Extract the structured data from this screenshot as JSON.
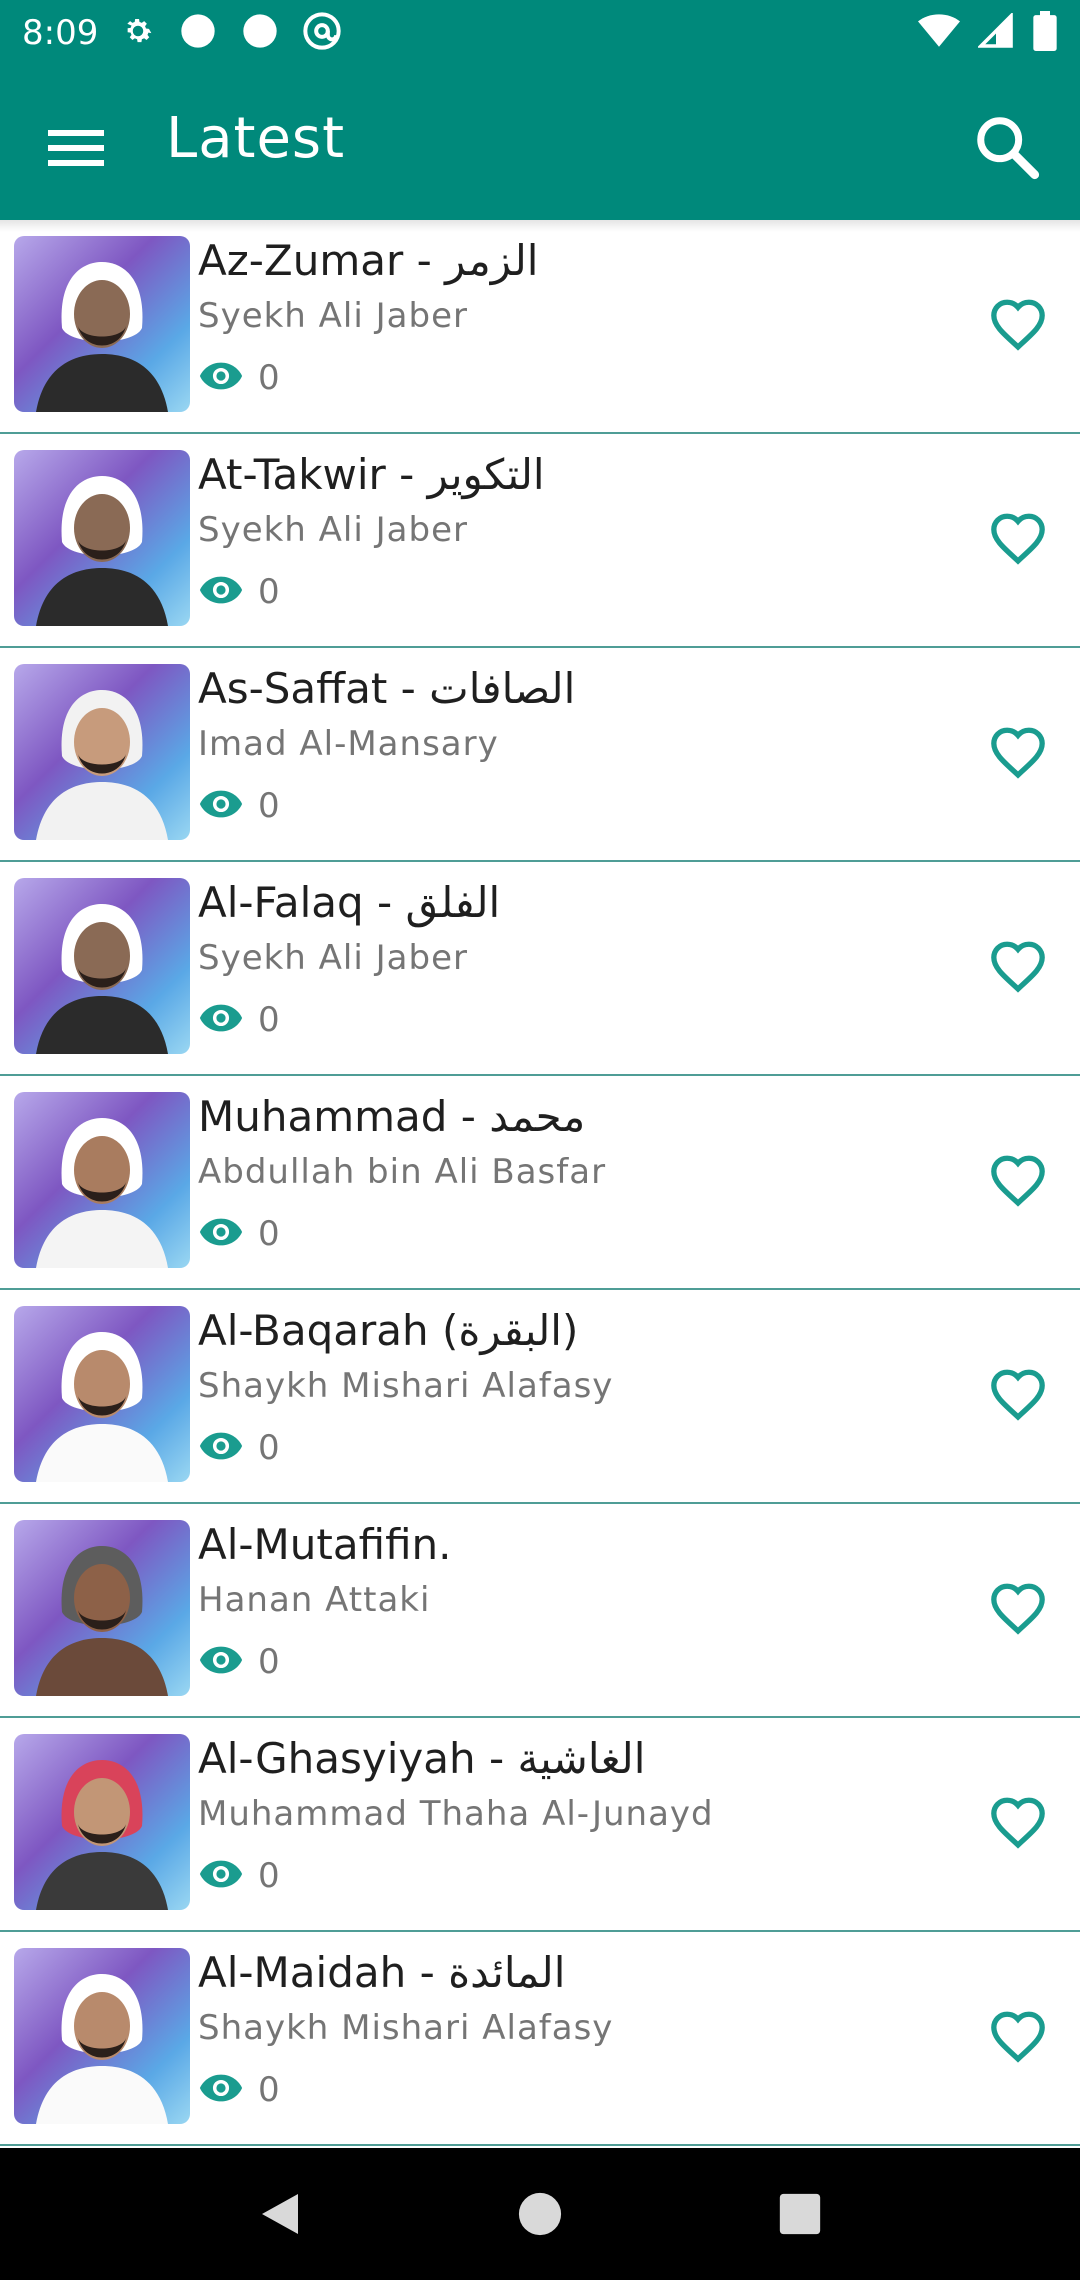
{
  "status_bar": {
    "time": "8:09",
    "icons_left": [
      "settings-icon",
      "circle-icon",
      "circle-icon",
      "at-sign-icon"
    ],
    "icons_right": [
      "wifi-icon",
      "signal-icon",
      "battery-icon"
    ]
  },
  "app_bar": {
    "title": "Latest",
    "menu_icon": "hamburger-menu-icon",
    "search_icon": "search-icon",
    "color": "#00897b"
  },
  "colors": {
    "accent": "#00897b",
    "icon_teal": "#1a9c8f",
    "divider": "#4f9d96"
  },
  "items": [
    {
      "title": "Az-Zumar - الزمر",
      "reciter": "Syekh Ali Jaber",
      "views": "0",
      "avatar": "reciter-photo-ali-jaber"
    },
    {
      "title": "At-Takwir - التكوير",
      "reciter": "Syekh Ali Jaber",
      "views": "0",
      "avatar": "reciter-photo-ali-jaber"
    },
    {
      "title": "As-Saffat - الصافات",
      "reciter": "Imad Al-Mansary",
      "views": "0",
      "avatar": "reciter-photo-imad-al-mansary"
    },
    {
      "title": "Al-Falaq - الفلق",
      "reciter": "Syekh Ali Jaber",
      "views": "0",
      "avatar": "reciter-photo-ali-jaber"
    },
    {
      "title": "Muhammad - محمد",
      "reciter": "Abdullah bin Ali Basfar",
      "views": "0",
      "avatar": "reciter-photo-basfar"
    },
    {
      "title": "Al-Baqarah (البقرة)",
      "reciter": "Shaykh Mishari Alafasy",
      "views": "0",
      "avatar": "reciter-photo-alafasy"
    },
    {
      "title": "Al-Mutafifin.",
      "reciter": "Hanan Attaki",
      "views": "0",
      "avatar": "reciter-photo-hanan-attaki"
    },
    {
      "title": "Al-Ghasyiyah - الغاشية",
      "reciter": "Muhammad Thaha Al-Junayd",
      "views": "0",
      "avatar": "reciter-photo-thaha-al-junayd"
    },
    {
      "title": "Al-Maidah - المائدة",
      "reciter": "Shaykh Mishari Alafasy",
      "views": "0",
      "avatar": "reciter-photo-alafasy"
    }
  ],
  "nav_bar": {
    "back_icon": "back-triangle-icon",
    "home_icon": "home-circle-icon",
    "recents_icon": "recents-square-icon"
  }
}
